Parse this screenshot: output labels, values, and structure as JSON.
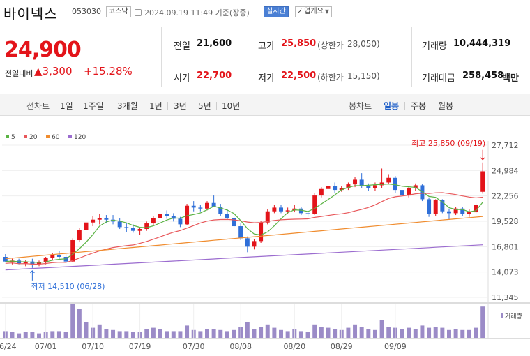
{
  "header": {
    "name": "바이넥스",
    "code": "053030",
    "market": "코스닥",
    "datetime": "2024.09.19 11:49 기준(장중)",
    "realtime_label": "실시간",
    "company_label": "기업개요"
  },
  "price": {
    "current": "24,900",
    "change_label": "전일대비",
    "change_abs": "3,300",
    "change_pct": "+15.28%"
  },
  "quotes": {
    "prev_label": "전일",
    "prev": "21,600",
    "high_label": "고가",
    "high": "25,850",
    "upper_label": "(상한가",
    "upper": "28,050)",
    "volume_label": "거래량",
    "volume": "10,444,319",
    "open_label": "시가",
    "open": "22,700",
    "low_label": "저가",
    "low": "22,500",
    "lower_label": "(하한가",
    "lower": "15,150)",
    "amount_label": "거래대금",
    "amount": "258,458",
    "amount_unit": "백만"
  },
  "periods": {
    "line_label": "선차트",
    "line_items": [
      "1일",
      "1주일",
      "3개월",
      "1년",
      "3년",
      "5년",
      "10년"
    ],
    "candle_label": "봉차트",
    "candle_items": [
      "일봉",
      "주봉",
      "월봉"
    ],
    "active": "일봉"
  },
  "chart_data": {
    "type": "candlestick",
    "ma_legend": [
      {
        "name": "5",
        "color": "#5ab343"
      },
      {
        "name": "20",
        "color": "#e8575a"
      },
      {
        "name": "60",
        "color": "#f08c2e"
      },
      {
        "name": "120",
        "color": "#9b6ccf"
      }
    ],
    "y_ticks": [
      27712,
      24984,
      22256,
      19528,
      16801,
      14073,
      11345
    ],
    "y_tick_labels": [
      "27,712",
      "24,984",
      "22,256",
      "19,528",
      "16,801",
      "14,073",
      "11,345"
    ],
    "x_labels": [
      "06/24",
      "07/01",
      "07/10",
      "07/19",
      "07/30",
      "08/08",
      "08/20",
      "08/29",
      "09/09"
    ],
    "high_annotation": "최고 25,850 (09/19)",
    "low_annotation": "최저 14,510 (06/28)",
    "volume_label": "거래량",
    "colors": {
      "up": "#e3141a",
      "down": "#2f6fd8"
    },
    "candles": [
      [
        15700,
        16000,
        15100,
        15200
      ],
      [
        15100,
        15500,
        14900,
        15300
      ],
      [
        15300,
        15500,
        14900,
        15000
      ],
      [
        15000,
        15400,
        14700,
        15200
      ],
      [
        15200,
        15500,
        14510,
        14900
      ],
      [
        14900,
        15300,
        14700,
        15100
      ],
      [
        15100,
        15700,
        14900,
        15600
      ],
      [
        15600,
        16100,
        15300,
        15900
      ],
      [
        15900,
        16300,
        15500,
        15700
      ],
      [
        15700,
        16000,
        15100,
        15200
      ],
      [
        15200,
        17700,
        15100,
        17500
      ],
      [
        17500,
        18800,
        17300,
        18600
      ],
      [
        18600,
        19600,
        18200,
        19400
      ],
      [
        19400,
        20100,
        19000,
        19700
      ],
      [
        19700,
        20300,
        19200,
        19900
      ],
      [
        19900,
        20200,
        19300,
        19700
      ],
      [
        19700,
        20200,
        19200,
        19500
      ],
      [
        19500,
        19900,
        18700,
        18900
      ],
      [
        18900,
        19300,
        18400,
        18800
      ],
      [
        18800,
        19200,
        18300,
        18500
      ],
      [
        18500,
        18900,
        18100,
        18700
      ],
      [
        18700,
        19500,
        18500,
        19300
      ],
      [
        19300,
        20100,
        19100,
        19900
      ],
      [
        19900,
        20600,
        19600,
        20300
      ],
      [
        20300,
        20700,
        19800,
        20100
      ],
      [
        20100,
        20400,
        19500,
        19800
      ],
      [
        19800,
        20000,
        18900,
        19200
      ],
      [
        19200,
        21400,
        19100,
        21200
      ],
      [
        21200,
        21700,
        20600,
        21000
      ],
      [
        21000,
        21300,
        20600,
        20900
      ],
      [
        20900,
        21700,
        20700,
        21500
      ],
      [
        21500,
        22300,
        21300,
        21100
      ],
      [
        21100,
        21400,
        20100,
        20300
      ],
      [
        20300,
        20800,
        19700,
        19900
      ],
      [
        19900,
        20100,
        18800,
        19000
      ],
      [
        19000,
        19300,
        17500,
        17700
      ],
      [
        17700,
        17900,
        16200,
        16800
      ],
      [
        16800,
        17600,
        16500,
        17400
      ],
      [
        17400,
        19600,
        17200,
        19400
      ],
      [
        19400,
        20800,
        19200,
        20600
      ],
      [
        20600,
        21300,
        20400,
        21000
      ],
      [
        21000,
        21300,
        20400,
        20600
      ],
      [
        20600,
        21000,
        20300,
        20700
      ],
      [
        20700,
        21300,
        20500,
        20900
      ],
      [
        20900,
        21100,
        20200,
        20400
      ],
      [
        20400,
        20700,
        20000,
        20300
      ],
      [
        20300,
        22600,
        20200,
        22300
      ],
      [
        22300,
        23200,
        22100,
        23000
      ],
      [
        23000,
        23600,
        22600,
        23300
      ],
      [
        23300,
        23700,
        22600,
        22900
      ],
      [
        22900,
        23300,
        22700,
        23100
      ],
      [
        23100,
        23700,
        22900,
        23500
      ],
      [
        23500,
        24300,
        23200,
        24000
      ],
      [
        24000,
        24700,
        23100,
        23300
      ],
      [
        23300,
        23600,
        22800,
        23100
      ],
      [
        23100,
        23700,
        22800,
        23400
      ],
      [
        23400,
        25200,
        23100,
        23700
      ],
      [
        23700,
        24600,
        23500,
        24200
      ],
      [
        24200,
        24400,
        22600,
        22900
      ],
      [
        22900,
        23300,
        22000,
        22300
      ],
      [
        22300,
        23300,
        22100,
        23100
      ],
      [
        23100,
        23600,
        22800,
        23400
      ],
      [
        23400,
        23500,
        21700,
        21900
      ],
      [
        21900,
        22100,
        20000,
        20300
      ],
      [
        20300,
        21900,
        20100,
        21800
      ],
      [
        21800,
        21900,
        20400,
        20600
      ],
      [
        20600,
        20900,
        19700,
        20400
      ],
      [
        20400,
        21100,
        20200,
        20900
      ],
      [
        20900,
        21100,
        20100,
        20300
      ],
      [
        20300,
        20800,
        20000,
        20500
      ],
      [
        20500,
        21500,
        20300,
        21300
      ],
      [
        22700,
        25850,
        22500,
        24900
      ]
    ],
    "volume": [
      6,
      5,
      4,
      5,
      5,
      4,
      5,
      6,
      6,
      5,
      30,
      26,
      14,
      9,
      12,
      8,
      7,
      6,
      6,
      5,
      5,
      8,
      9,
      8,
      6,
      6,
      6,
      11,
      7,
      6,
      8,
      8,
      7,
      6,
      7,
      10,
      14,
      8,
      10,
      12,
      9,
      7,
      6,
      8,
      6,
      5,
      12,
      10,
      9,
      8,
      7,
      9,
      12,
      10,
      8,
      7,
      16,
      10,
      9,
      8,
      9,
      8,
      11,
      9,
      10,
      9,
      7,
      8,
      7,
      7,
      9,
      28
    ]
  }
}
